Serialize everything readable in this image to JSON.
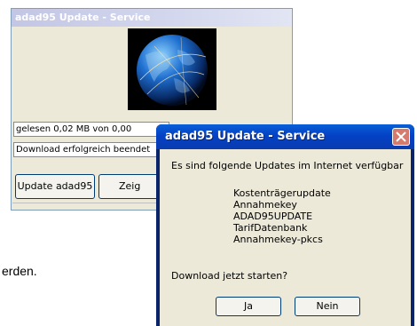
{
  "background_window": {
    "title": "adad95 Update - Service",
    "status_lines": [
      "gelesen 0,02 MB von 0,00",
      "Download erfolgreich beendet"
    ],
    "buttons": [
      "Update adad95",
      "Zeig"
    ]
  },
  "partial_text": "erden.",
  "dialog": {
    "title": "adad95 Update - Service",
    "message": "Es sind folgende Updates im Internet verfügbar",
    "updates": [
      "Kostenträgerupdate",
      "Annahmekey",
      "ADAD95UPDATE",
      "TarifDatenbank",
      "Annahmekey-pkcs"
    ],
    "question": "Download jetzt starten?",
    "buttons": {
      "yes": "Ja",
      "no": "Nein"
    }
  },
  "colors": {
    "titlebar_blue": "#0341c5",
    "dialog_bg": "#ece9d8",
    "close_button": "#d77a6e"
  }
}
